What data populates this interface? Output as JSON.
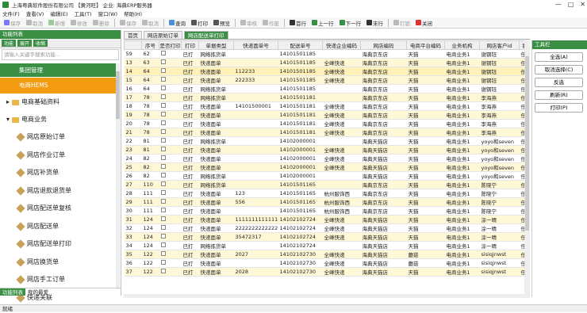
{
  "window": {
    "title": "上海粤典软件股份有限公司 【黄河旺】 企业: 海典ERP服务器",
    "controls": [
      "—",
      "□",
      "✕"
    ]
  },
  "menu": [
    "文件(F)",
    "查看(V)",
    "编辑(E)",
    "工具(T)",
    "窗口(W)",
    "帮助(H)"
  ],
  "toolbar": [
    {
      "label": "保存",
      "enabled": false,
      "icon": "save-icon",
      "color": "#7a7aff"
    },
    {
      "label": "取消",
      "enabled": false,
      "icon": "cancel-icon",
      "color": "#bbb"
    },
    {
      "label": "新增",
      "enabled": false,
      "icon": "add-icon",
      "color": "#9c9"
    },
    {
      "label": "修改",
      "enabled": false,
      "icon": "edit-icon",
      "color": "#bbb"
    },
    {
      "label": "删除",
      "enabled": false,
      "icon": "delete-icon",
      "color": "#bbb"
    },
    {
      "label": "保存",
      "enabled": false,
      "icon": "save-icon",
      "color": "#bbb"
    },
    {
      "label": "取消",
      "enabled": false,
      "icon": "cancel-icon",
      "color": "#bbb"
    },
    {
      "label": "查询",
      "enabled": true,
      "icon": "search-icon",
      "color": "#4a90d9"
    },
    {
      "label": "打印",
      "enabled": true,
      "icon": "print-icon",
      "color": "#555"
    },
    {
      "label": "预览",
      "enabled": true,
      "icon": "preview-icon",
      "color": "#555"
    },
    {
      "label": "审核",
      "enabled": false,
      "icon": "audit-icon",
      "color": "#bbb"
    },
    {
      "label": "作废",
      "enabled": false,
      "icon": "void-icon",
      "color": "#bbb"
    },
    {
      "label": "首行",
      "enabled": true,
      "icon": "first-icon",
      "color": "#333"
    },
    {
      "label": "上一行",
      "enabled": true,
      "icon": "prev-icon",
      "color": "#3a8f45"
    },
    {
      "label": "下一行",
      "enabled": true,
      "icon": "next-icon",
      "color": "#3a8f45"
    },
    {
      "label": "末行",
      "enabled": true,
      "icon": "last-icon",
      "color": "#333"
    },
    {
      "label": "钉锁",
      "enabled": false,
      "icon": "pin-icon",
      "color": "#bbb"
    },
    {
      "label": "关闭",
      "enabled": true,
      "icon": "close-icon",
      "color": "#d33"
    }
  ],
  "sidebar": {
    "header": "功能列表",
    "tools": [
      {
        "label": "功能",
        "color": "#3a8f45"
      },
      {
        "label": "展开",
        "color": "#3a8f45"
      },
      {
        "label": "收缩",
        "color": "#3a8f45"
      }
    ],
    "search_placeholder": "请输入关键字搜索功能...",
    "groups": [
      {
        "label": "集团管理",
        "style": "green"
      },
      {
        "label": "电商HEMS",
        "style": "orange"
      }
    ],
    "folders": [
      "电商基础资料",
      "电商业务"
    ],
    "leaves": [
      "网店原始订单",
      "网店作业订单",
      "网店补货单",
      "网店退款退货单",
      "网店配送单复核",
      "网店配送单",
      "网店配送单打印",
      "网店换货单",
      "网店手工订单",
      "快递关联"
    ],
    "bottom_tabs": [
      "功能列表",
      "我的最爱"
    ]
  },
  "tabs": [
    "首页",
    "网店原始订单",
    "网店配送单打印"
  ],
  "grid": {
    "columns": [
      "",
      "序号",
      "是否打印",
      "打印",
      "单据类型",
      "快递面单号",
      "配送单号",
      "快递企业编码",
      "网店编码",
      "电商平台编码",
      "业务机构",
      "网店客户id",
      "客"
    ],
    "rows": [
      [
        "59",
        "62",
        "",
        "已打",
        "网络拣货单",
        "",
        "14101501185",
        "",
        "海典京东店",
        "天猫",
        "电商业务1",
        "谢钢钰",
        "任"
      ],
      [
        "13",
        "63",
        "",
        "已打",
        "快递面单",
        "",
        "14101501185",
        "全峰快递",
        "海典京东店",
        "天猫",
        "电商业务1",
        "谢钢钰",
        "任"
      ],
      [
        "14",
        "64",
        "",
        "已打",
        "快递面单",
        "112233",
        "14101501185",
        "全峰快递",
        "海典京东店",
        "天猫",
        "电商业务1",
        "谢钢钰",
        "任"
      ],
      [
        "15",
        "64",
        "",
        "已打",
        "快递面单",
        "222333",
        "14101501185",
        "全峰快递",
        "海典京东店",
        "天猫",
        "电商业务1",
        "谢钢钰",
        "任"
      ],
      [
        "16",
        "64",
        "",
        "已打",
        "网络拣货单",
        "",
        "14101501185",
        "",
        "海典京东店",
        "天猫",
        "电商业务1",
        "谢钢钰",
        "任"
      ],
      [
        "17",
        "78",
        "",
        "已打",
        "网络拣货单",
        "",
        "14101501181",
        "",
        "海典京东店",
        "天猫",
        "电商业务1",
        "李海燕",
        "任"
      ],
      [
        "18",
        "78",
        "",
        "已打",
        "快递面单",
        "14101500001",
        "14101501181",
        "全峰快递",
        "海典京东店",
        "天猫",
        "电商业务1",
        "李海燕",
        "任"
      ],
      [
        "19",
        "78",
        "",
        "已打",
        "快递面单",
        "",
        "14101501181",
        "全峰快递",
        "海典京东店",
        "天猫",
        "电商业务1",
        "李海燕",
        "任"
      ],
      [
        "20",
        "78",
        "",
        "已打",
        "快递面单",
        "",
        "14101501181",
        "全峰快递",
        "海典京东店",
        "天猫",
        "电商业务1",
        "李海燕",
        "任"
      ],
      [
        "21",
        "78",
        "",
        "已打",
        "快递面单",
        "",
        "14101501181",
        "全峰快递",
        "海典京东店",
        "天猫",
        "电商业务1",
        "李海燕",
        "任"
      ],
      [
        "22",
        "81",
        "",
        "已打",
        "网络拣货单",
        "",
        "14102000001",
        "",
        "海典天猫店",
        "天猫",
        "电商业务1",
        "yoyo和seven",
        "任"
      ],
      [
        "23",
        "81",
        "",
        "已打",
        "快递面单",
        "",
        "14102000001",
        "全峰快递",
        "海典天猫店",
        "天猫",
        "电商业务1",
        "yoyo和seven",
        "任"
      ],
      [
        "24",
        "82",
        "",
        "已打",
        "快递面单",
        "",
        "14102000001",
        "全峰快递",
        "海典天猫店",
        "天猫",
        "电商业务1",
        "yoyo和seven",
        "任"
      ],
      [
        "25",
        "82",
        "",
        "已打",
        "快递面单",
        "",
        "14102000001",
        "全峰快递",
        "海典天猫店",
        "天猫",
        "电商业务1",
        "yoyo和seven",
        "任"
      ],
      [
        "26",
        "82",
        "",
        "已打",
        "网络拣货单",
        "",
        "14102000001",
        "",
        "海典天猫店",
        "天猫",
        "电商业务1",
        "yoyo和seven",
        "任"
      ],
      [
        "27",
        "110",
        "",
        "已打",
        "网络拣货单",
        "",
        "14101501165",
        "",
        "海典京东店",
        "天猫",
        "电商业务1",
        "陈晓宁",
        "任"
      ],
      [
        "28",
        "111",
        "",
        "已打",
        "快递面单",
        "123",
        "14101501165",
        "杭州服饰西",
        "海典京东店",
        "天猫",
        "电商业务1",
        "陈晓宁",
        "任"
      ],
      [
        "29",
        "111",
        "",
        "已打",
        "快递面单",
        "556",
        "14101501165",
        "杭州服饰西",
        "海典京东店",
        "天猫",
        "电商业务1",
        "陈晓宁",
        "任"
      ],
      [
        "30",
        "111",
        "",
        "已打",
        "快递面单",
        "",
        "14101501165",
        "杭州服饰西",
        "海典京东店",
        "天猫",
        "电商业务1",
        "陈晓宁",
        "任"
      ],
      [
        "31",
        "124",
        "",
        "已打",
        "快递面单",
        "1111111111111",
        "14102102724",
        "全峰快递",
        "海典天猫店",
        "天猫",
        "电商业务1",
        "涂一晴",
        "任"
      ],
      [
        "32",
        "124",
        "",
        "已打",
        "快递面单",
        "2222222222222",
        "14102102724",
        "全峰快递",
        "海典天猫店",
        "天猫",
        "电商业务1",
        "涂一晴",
        "任"
      ],
      [
        "33",
        "124",
        "",
        "已打",
        "快递面单",
        "35472317",
        "14102102724",
        "全峰快递",
        "海典天猫店",
        "天猫",
        "电商业务1",
        "涂一晴",
        "任"
      ],
      [
        "34",
        "124",
        "",
        "已打",
        "网络拣货单",
        "",
        "14102102724",
        "",
        "海典天猫店",
        "天猫",
        "电商业务1",
        "涂一晴",
        "任"
      ],
      [
        "35",
        "122",
        "",
        "已打",
        "快递面单",
        "2027",
        "14102102730",
        "全峰快递",
        "海典天猫店",
        "蘑菇",
        "电商业务1",
        "sisiqjnwst",
        "任"
      ],
      [
        "36",
        "122",
        "",
        "已打",
        "快递面单",
        "",
        "14102102730",
        "全峰快递",
        "海典天猫店",
        "蘑菇",
        "电商业务1",
        "sisiqjnwst",
        "任"
      ],
      [
        "37",
        "122",
        "",
        "已打",
        "快递面单",
        "2028",
        "14102102730",
        "全峰快递",
        "海典天猫店",
        "天猫",
        "电商业务1",
        "sisiqjnwst",
        "任"
      ]
    ]
  },
  "right_panel": {
    "header": "工具栏",
    "buttons": [
      "全选(A)",
      "取消选择(C)",
      "反选",
      "刷新(R)",
      "打印(P)"
    ]
  },
  "status": "就绪"
}
